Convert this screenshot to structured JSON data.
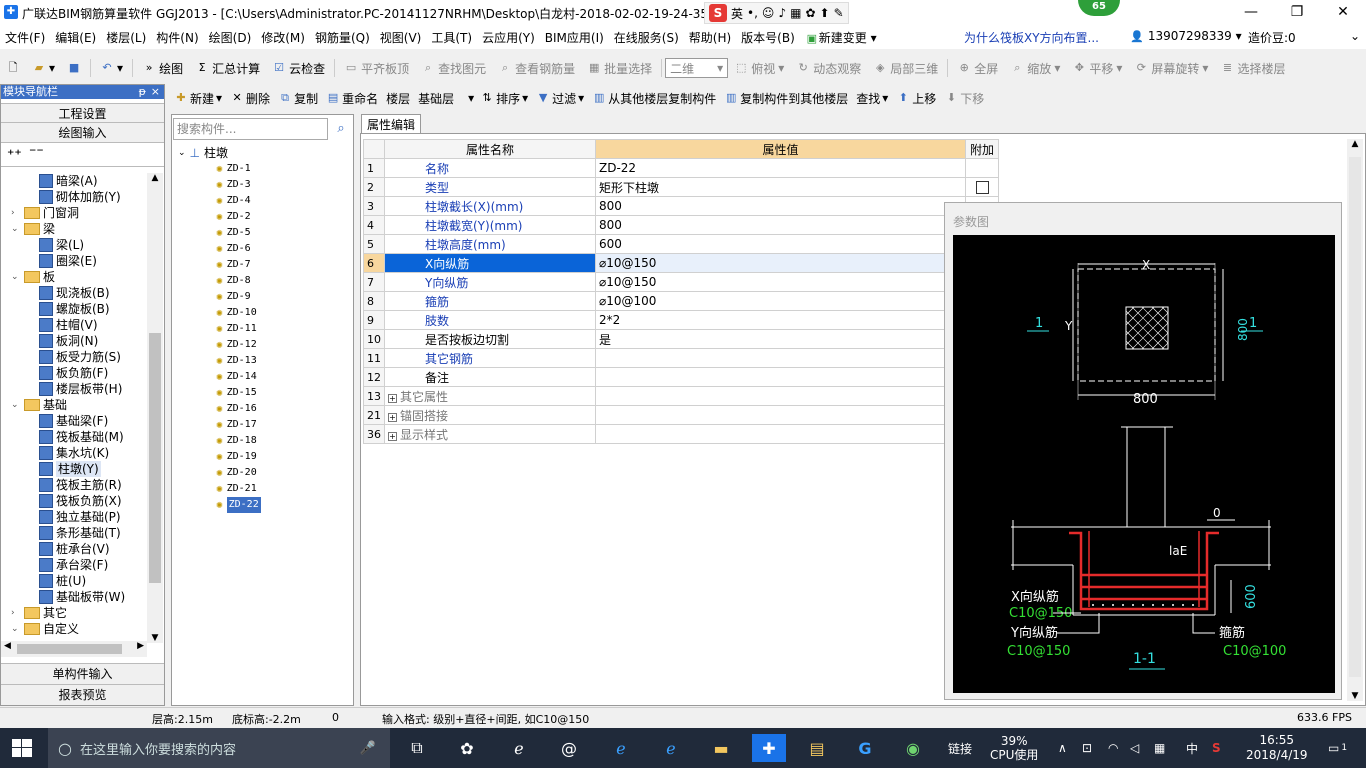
{
  "window": {
    "title": "广联达BIM钢筋算量软件 GGJ2013 - [C:\\Users\\Administrator.PC-20141127NRHM\\Desktop\\白龙村-2018-02-02-19-24-35",
    "badge": "65",
    "ime_label": "英"
  },
  "menu": {
    "items": [
      "文件(F)",
      "编辑(E)",
      "楼层(L)",
      "构件(N)",
      "绘图(D)",
      "修改(M)",
      "钢筋量(Q)",
      "视图(V)",
      "工具(T)",
      "云应用(Y)",
      "BIM应用(I)",
      "在线服务(S)",
      "帮助(H)",
      "版本号(B)",
      "新建变更"
    ],
    "promo": "为什么筏板XY方向布置...",
    "phone": "13907298339",
    "coins": "造价豆:0"
  },
  "toolbar1": {
    "draw": "绘图",
    "summary": "汇总计算",
    "cloud_check": "云检查",
    "align_top": "平齐板顶",
    "find_elem": "查找图元",
    "view_rebar": "查看钢筋量",
    "batch_select": "批量选择",
    "view_mode": "二维",
    "top_view": "俯视",
    "dyn_view": "动态观察",
    "local_3d": "局部三维",
    "fullscreen": "全屏",
    "zoom": "缩放",
    "pan": "平移",
    "rotate": "屏幕旋转",
    "select_layer": "选择楼层"
  },
  "toolbar2": {
    "new": "新建",
    "delete": "删除",
    "copy": "复制",
    "rename": "重命名",
    "floor_label": "楼层",
    "floor_value": "基础层",
    "sort": "排序",
    "filter": "过滤",
    "copy_from": "从其他楼层复制构件",
    "copy_to": "复制构件到其他楼层",
    "find": "查找",
    "move_up": "上移",
    "move_down": "下移"
  },
  "nav": {
    "header": "模块导航栏",
    "project_settings": "工程设置",
    "drawing_input": "绘图输入",
    "single_input": "单构件输入",
    "report_preview": "报表预览",
    "tree": [
      {
        "label": "暗梁(A)",
        "level": 2
      },
      {
        "label": "砌体加筋(Y)",
        "level": 2
      },
      {
        "label": "门窗洞",
        "level": 1,
        "folder": true,
        "collapsed": true
      },
      {
        "label": "梁",
        "level": 1,
        "folder": true
      },
      {
        "label": "梁(L)",
        "level": 2
      },
      {
        "label": "圈梁(E)",
        "level": 2
      },
      {
        "label": "板",
        "level": 1,
        "folder": true
      },
      {
        "label": "现浇板(B)",
        "level": 2
      },
      {
        "label": "螺旋板(B)",
        "level": 2
      },
      {
        "label": "柱帽(V)",
        "level": 2
      },
      {
        "label": "板洞(N)",
        "level": 2
      },
      {
        "label": "板受力筋(S)",
        "level": 2
      },
      {
        "label": "板负筋(F)",
        "level": 2
      },
      {
        "label": "楼层板带(H)",
        "level": 2
      },
      {
        "label": "基础",
        "level": 1,
        "folder": true
      },
      {
        "label": "基础梁(F)",
        "level": 2
      },
      {
        "label": "筏板基础(M)",
        "level": 2
      },
      {
        "label": "集水坑(K)",
        "level": 2
      },
      {
        "label": "柱墩(Y)",
        "level": 2,
        "selected": true
      },
      {
        "label": "筏板主筋(R)",
        "level": 2
      },
      {
        "label": "筏板负筋(X)",
        "level": 2
      },
      {
        "label": "独立基础(P)",
        "level": 2
      },
      {
        "label": "条形基础(T)",
        "level": 2
      },
      {
        "label": "桩承台(V)",
        "level": 2
      },
      {
        "label": "承台梁(F)",
        "level": 2
      },
      {
        "label": "桩(U)",
        "level": 2
      },
      {
        "label": "基础板带(W)",
        "level": 2
      },
      {
        "label": "其它",
        "level": 1,
        "folder": true,
        "collapsed": true
      },
      {
        "label": "自定义",
        "level": 1,
        "folder": true
      }
    ]
  },
  "components": {
    "search_placeholder": "搜索构件...",
    "root": "柱墩",
    "items": [
      "ZD-1",
      "ZD-3",
      "ZD-4",
      "ZD-2",
      "ZD-5",
      "ZD-6",
      "ZD-7",
      "ZD-8",
      "ZD-9",
      "ZD-10",
      "ZD-11",
      "ZD-12",
      "ZD-13",
      "ZD-14",
      "ZD-15",
      "ZD-16",
      "ZD-17",
      "ZD-18",
      "ZD-19",
      "ZD-20",
      "ZD-21",
      "ZD-22"
    ],
    "selected": "ZD-22"
  },
  "props": {
    "tab": "属性编辑",
    "col_name": "属性名称",
    "col_value": "属性值",
    "col_extra": "附加",
    "rows": [
      {
        "n": "1",
        "k": "名称",
        "v": "ZD-22",
        "style": "blue"
      },
      {
        "n": "2",
        "k": "类型",
        "v": "矩形下柱墩",
        "style": "blue",
        "check": true
      },
      {
        "n": "3",
        "k": "柱墩截长(X)(mm)",
        "v": "800",
        "style": "blue"
      },
      {
        "n": "4",
        "k": "柱墩截宽(Y)(mm)",
        "v": "800",
        "style": "blue"
      },
      {
        "n": "5",
        "k": "柱墩高度(mm)",
        "v": "600",
        "style": "blue"
      },
      {
        "n": "6",
        "k": "X向纵筋",
        "v": "⌀10@150",
        "style": "blue",
        "selected": true
      },
      {
        "n": "7",
        "k": "Y向纵筋",
        "v": "⌀10@150",
        "style": "blue"
      },
      {
        "n": "8",
        "k": "箍筋",
        "v": "⌀10@100",
        "style": "blue"
      },
      {
        "n": "9",
        "k": "肢数",
        "v": "2*2",
        "style": "blue"
      },
      {
        "n": "10",
        "k": "是否按板边切割",
        "v": "是",
        "style": "black"
      },
      {
        "n": "11",
        "k": "其它钢筋",
        "v": "",
        "style": "blue"
      },
      {
        "n": "12",
        "k": "备注",
        "v": "",
        "style": "black"
      },
      {
        "n": "13",
        "k": "其它属性",
        "v": "",
        "style": "gray",
        "expand": true
      },
      {
        "n": "21",
        "k": "锚固搭接",
        "v": "",
        "style": "gray",
        "expand": true
      },
      {
        "n": "36",
        "k": "显示样式",
        "v": "",
        "style": "gray",
        "expand": true
      }
    ]
  },
  "param": {
    "title": "参数图",
    "x_label": "X",
    "y_label": "Y",
    "dim_800_h": "800",
    "dim_800_v": "800",
    "sec_mark": "1",
    "dim_0": "0",
    "lae": "laE",
    "dim_600": "600",
    "x_rebar": "X向纵筋",
    "x_rebar_val": "C10@150",
    "y_rebar": "Y向纵筋",
    "y_rebar_val": "C10@150",
    "stirrup": "箍筋",
    "stirrup_val": "C10@100",
    "section": "1-1"
  },
  "status": {
    "floor_height": "层高:2.15m",
    "bottom_elev": "底标高:-2.2m",
    "zero": "0",
    "hint": "输入格式: 级别+直径+间距, 如C10@150",
    "fps": "633.6 FPS"
  },
  "taskbar": {
    "search_placeholder": "在这里输入你要搜索的内容",
    "link": "链接",
    "cpu_pct": "39%",
    "cpu_label": "CPU使用",
    "lang": "中",
    "time": "16:55",
    "date": "2018/4/19",
    "notif": "1"
  }
}
